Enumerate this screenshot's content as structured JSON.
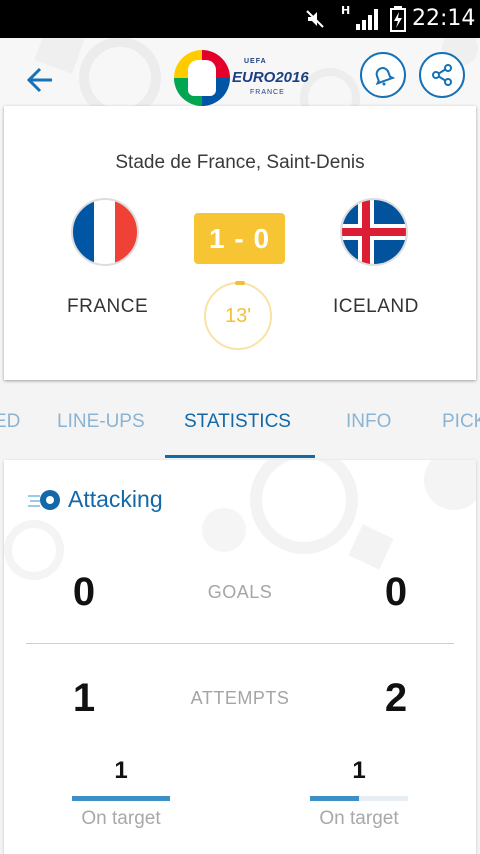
{
  "status_bar": {
    "network_label": "H",
    "time": "22:14"
  },
  "header": {
    "logo": {
      "uefa": "UEFA",
      "euro": "EURO2016",
      "country": "FRANCE"
    },
    "colors": {
      "accent": "#1571b8"
    }
  },
  "match": {
    "venue": "Stade de France, Saint-Denis",
    "home": {
      "name": "FRANCE"
    },
    "away": {
      "name": "ICELAND"
    },
    "score": "1 - 0",
    "minute": "13'",
    "colors": {
      "score_badge": "#f7c434",
      "minute": "#f0c03c"
    }
  },
  "tabs": [
    {
      "label": "ED"
    },
    {
      "label": "LINE-UPS"
    },
    {
      "label": "STATISTICS",
      "active": true
    },
    {
      "label": "INFO"
    },
    {
      "label": "PICK"
    }
  ],
  "stats": {
    "section_title": "Attacking",
    "goals": {
      "label": "GOALS",
      "home": "0",
      "away": "0"
    },
    "attempts": {
      "label": "ATTEMPTS",
      "home": "1",
      "away": "2"
    },
    "on_target": {
      "label": "On target",
      "home": "1",
      "away": "1",
      "home_fraction": 1.0,
      "away_fraction": 0.5
    }
  }
}
